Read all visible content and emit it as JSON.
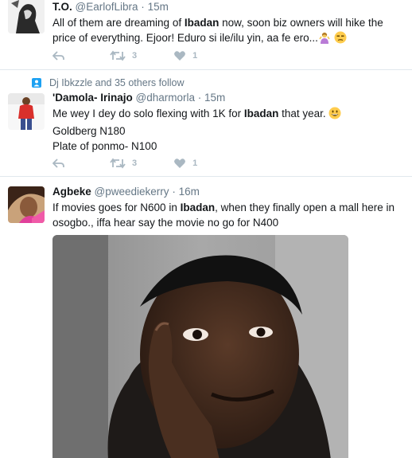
{
  "tweets": [
    {
      "name": "T.O.",
      "handle": "@EarlofLibra",
      "separator": "·",
      "time": "15m",
      "text_before": "All of them are dreaming of ",
      "text_bold": "Ibadan",
      "text_after": " now, soon biz owners will hike the price of everything. Ejoor! Eduro si ile/ilu yin, aa fe ero...",
      "retweets": "3",
      "likes": "1",
      "emojis": [
        "person-gesturing-icon",
        "unamused-face-icon"
      ]
    },
    {
      "social_context": "Dj Ibkzzle and 35 others follow",
      "name": "'Damola- Irinajo",
      "handle": "@dharmorla",
      "separator": "·",
      "time": "15m",
      "text_before": "Me wey I dey do solo flexing with 1K for ",
      "text_bold": "Ibadan",
      "text_after": " that year.",
      "line2": "Goldberg N180",
      "line3": "Plate of ponmo- N100",
      "retweets": "3",
      "likes": "1",
      "emojis": [
        "grinning-face-icon"
      ]
    },
    {
      "name": "Agbeke",
      "handle": "@pweediekerry",
      "separator": "·",
      "time": "16m",
      "text_before": "If movies goes for N600 in ",
      "text_bold": "Ibadan",
      "text_after": ", when they finally open a mall here in osogbo., iffa hear say the movie no go for N400"
    }
  ],
  "colors": {
    "text": "#14171a",
    "secondary": "#657786",
    "action_icon": "#aab8c2",
    "divider": "#e1e8ed",
    "follow_badge": "#1da1f2"
  }
}
